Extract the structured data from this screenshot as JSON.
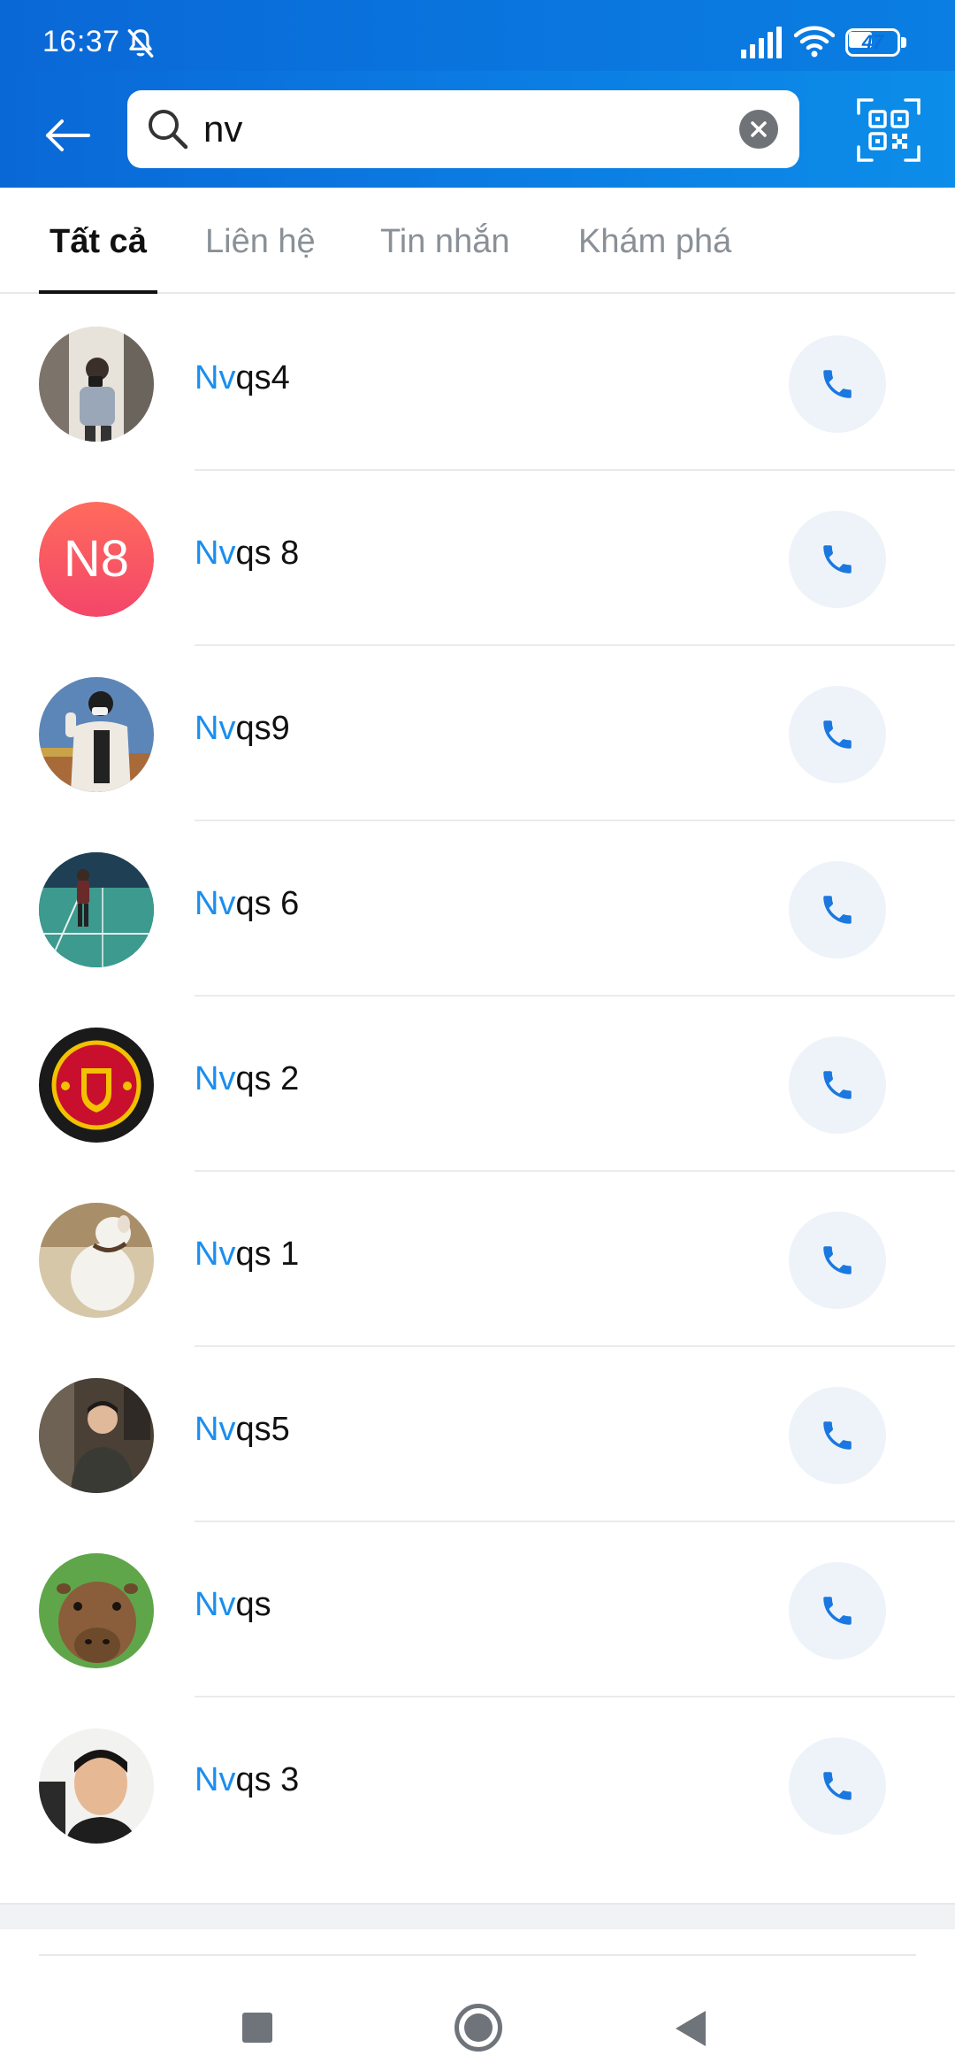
{
  "status_bar": {
    "time": "16:37",
    "battery": "47",
    "icons": [
      "mute-bell-icon",
      "signal-icon",
      "wifi-icon",
      "battery-icon"
    ]
  },
  "header": {
    "search_value": "nv",
    "icons": [
      "back-arrow-icon",
      "search-icon",
      "clear-icon",
      "qr-scan-icon"
    ],
    "accent_color": "#0a74dd"
  },
  "tabs": [
    {
      "label": "Tất cả",
      "active": true
    },
    {
      "label": "Liên hệ",
      "active": false
    },
    {
      "label": "Tin nhắn",
      "active": false
    },
    {
      "label": "Khám phá",
      "active": false
    }
  ],
  "contacts": [
    {
      "match": "Nv",
      "rest": "qs4",
      "avatar": "photo"
    },
    {
      "match": "Nv",
      "rest": "qs 8",
      "avatar": "initials",
      "initials": "N8"
    },
    {
      "match": "Nv",
      "rest": "qs9",
      "avatar": "photo"
    },
    {
      "match": "Nv",
      "rest": "qs 6",
      "avatar": "photo"
    },
    {
      "match": "Nv",
      "rest": "qs 2",
      "avatar": "photo"
    },
    {
      "match": "Nv",
      "rest": "qs 1",
      "avatar": "photo"
    },
    {
      "match": "Nv",
      "rest": "qs5",
      "avatar": "photo"
    },
    {
      "match": "Nv",
      "rest": "qs",
      "avatar": "photo"
    },
    {
      "match": "Nv",
      "rest": "qs 3",
      "avatar": "photo"
    }
  ],
  "colors": {
    "highlight": "#1a8ef0",
    "call_icon": "#1a78e0",
    "call_bg": "#eef3f9"
  },
  "nav_bar": {
    "icons": [
      "recent-apps-icon",
      "home-icon",
      "back-triangle-icon"
    ]
  }
}
